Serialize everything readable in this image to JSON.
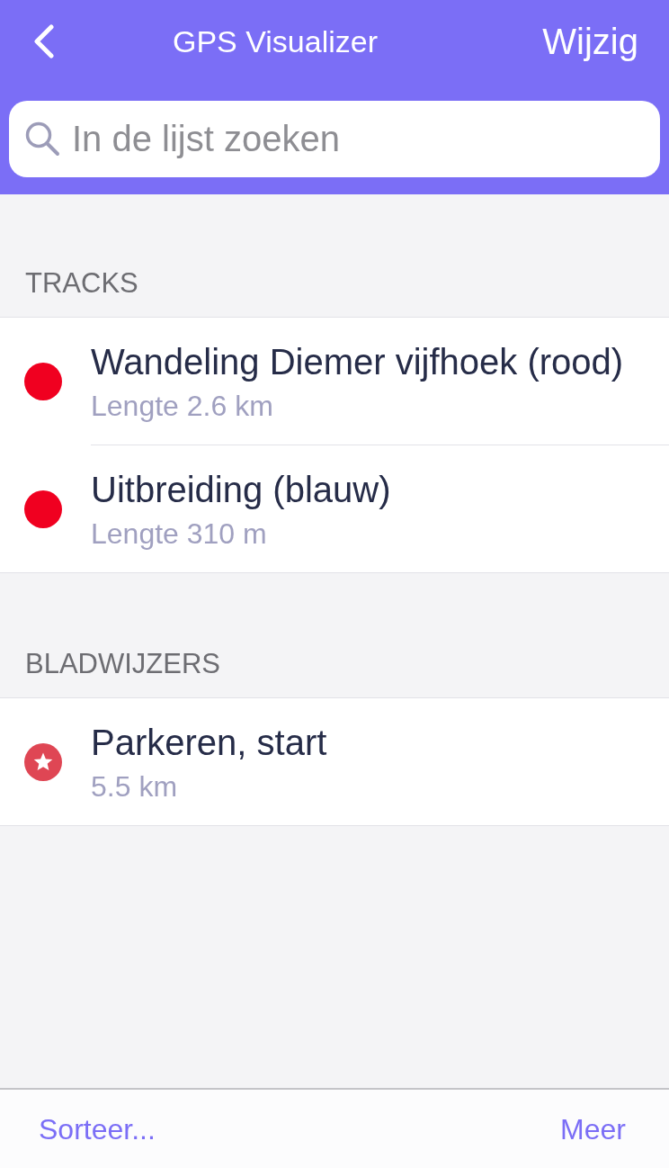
{
  "nav": {
    "title": "GPS Visualizer",
    "action": "Wijzig"
  },
  "search": {
    "placeholder": "In de lijst zoeken"
  },
  "sections": [
    {
      "header": "TRACKS",
      "kind": "track",
      "items": [
        {
          "title": "Wandeling Diemer vijfhoek (rood)",
          "subtitle": "Lengte 2.6 km",
          "color": "#f00020"
        },
        {
          "title": "Uitbreiding (blauw)",
          "subtitle": "Lengte 310 m",
          "color": "#f00020"
        }
      ]
    },
    {
      "header": "BLADWIJZERS",
      "kind": "bookmark",
      "items": [
        {
          "title": "Parkeren, start",
          "subtitle": "5.5 km",
          "color": "#df4654"
        }
      ]
    }
  ],
  "toolbar": {
    "left": "Sorteer...",
    "right": "Meer"
  }
}
